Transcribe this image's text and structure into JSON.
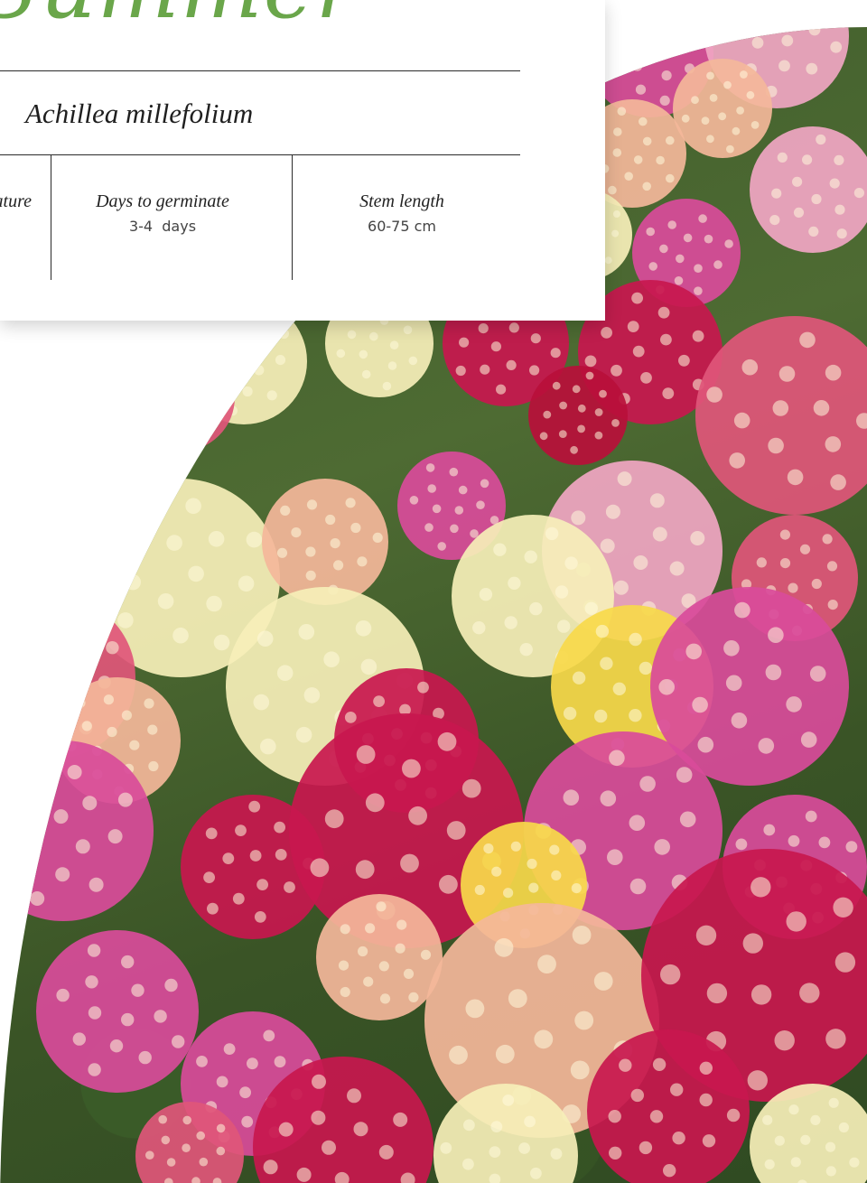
{
  "card": {
    "title": "Summer",
    "latin_name": "Achillea millefolium",
    "specs": [
      {
        "label": "Temperature",
        "value": ""
      },
      {
        "label": "Days to germinate",
        "value": "3-4  days"
      },
      {
        "label": "Stem length",
        "value": "60-75 cm"
      }
    ]
  },
  "colors": {
    "title_green": "#6aa64a",
    "foliage": "#3d5a2a",
    "flower_colors": [
      "#c8174e",
      "#e0567a",
      "#f1a6c3",
      "#f6efb8",
      "#f7d94a",
      "#f4b79a",
      "#d94b9a",
      "#b80f3a"
    ]
  }
}
